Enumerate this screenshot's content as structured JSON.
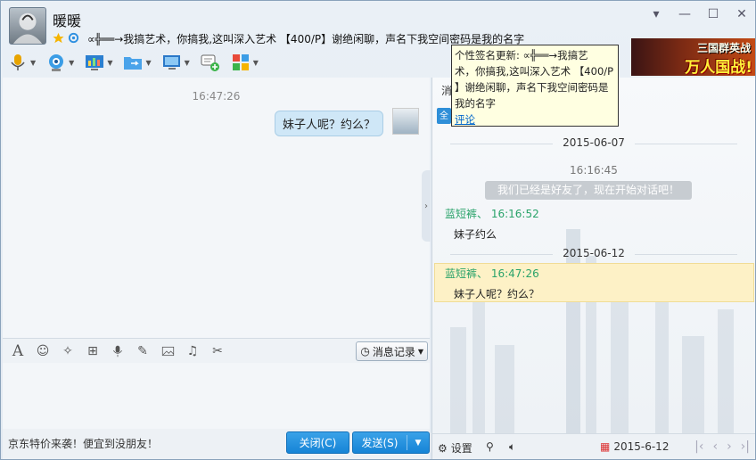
{
  "contact": {
    "name": "暖暖",
    "signature": "∝╬══→我搞艺术，你搞我,这叫深入艺术 【400/P】谢绝闲聊，声名下我空间密码是我的名字"
  },
  "window_controls": [
    "▾",
    "—",
    "☐",
    "✕"
  ],
  "toolbar": {
    "items": [
      "voice-call",
      "video-call",
      "remote-desktop",
      "send-file",
      "share-screen",
      "new-discussion",
      "apps"
    ]
  },
  "ad": {
    "line1": "三国群英战",
    "line2": "万人国战!"
  },
  "tooltip": {
    "line1": "个性签名更新: ∝╬══→我搞艺",
    "line2": "术，你搞我,这叫深入艺术 【400/P",
    "line3": "】谢绝闲聊，声名下我空间密码是",
    "line4": "我的名字",
    "link": "评论"
  },
  "chat": {
    "time": "16:47:26",
    "message": "妹子人呢？约么？"
  },
  "input_toolbar": {
    "history_label": "消息记录"
  },
  "footer": {
    "promo": "京东特价来袭！便宜到没朋友！",
    "close_label": "关闭(C)",
    "send_label": "发送(S)"
  },
  "history": {
    "tab_label": "消",
    "tab2_label": "全",
    "date1": "2015-06-07",
    "time1": "16:16:45",
    "system_msg": "我们已经是好友了，现在开始对话吧！",
    "sender1": "蓝短裤、 16:16:52",
    "msg1": "妹子约么",
    "date2": "2015-06-12",
    "sender2": "蓝短裤、 16:47:26",
    "msg2": "妹子人呢？约么？",
    "footer_settings": "设置",
    "footer_date": "2015-6-12"
  },
  "colors": {
    "accent": "#1684d6",
    "sender": "#2aa36a",
    "highlight": "#fdf1c6"
  }
}
